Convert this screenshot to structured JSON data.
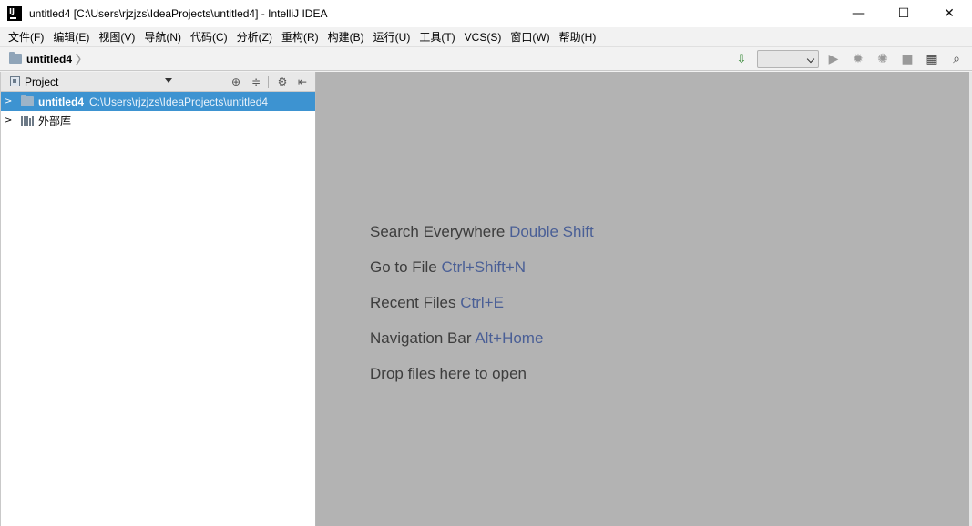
{
  "window": {
    "title": "untitled4 [C:\\Users\\rjzjzs\\IdeaProjects\\untitled4] - IntelliJ IDEA",
    "minimize_glyph": "—",
    "maximize_glyph": "☐",
    "close_glyph": "✕"
  },
  "menu": {
    "items": [
      {
        "label": "文件(F)"
      },
      {
        "label": "编辑(E)"
      },
      {
        "label": "视图(V)"
      },
      {
        "label": "导航(N)"
      },
      {
        "label": "代码(C)"
      },
      {
        "label": "分析(Z)"
      },
      {
        "label": "重构(R)"
      },
      {
        "label": "构建(B)"
      },
      {
        "label": "运行(U)"
      },
      {
        "label": "工具(T)"
      },
      {
        "label": "VCS(S)"
      },
      {
        "label": "窗口(W)"
      },
      {
        "label": "帮助(H)"
      }
    ]
  },
  "navbar": {
    "breadcrumb": "untitled4",
    "separator": "〉",
    "run_config_value": ""
  },
  "toolbar": {
    "icons": {
      "sort": "⇩",
      "run": "▶",
      "debug": "✹",
      "coverage": "✺",
      "stop": "■",
      "project_structure": "▦",
      "search": "⌕"
    }
  },
  "project_panel": {
    "title": "Project",
    "tools": {
      "locate": "⊕",
      "collapse": "≑",
      "settings": "⚙",
      "hide": "⇤"
    },
    "tree": [
      {
        "arrow": ">",
        "name": "untitled4",
        "path": "C:\\Users\\rjzjzs\\IdeaProjects\\untitled4",
        "selected": true
      },
      {
        "arrow": ">",
        "name": "外部库",
        "selected": false
      }
    ]
  },
  "editor": {
    "hints": [
      {
        "text": "Search Everywhere",
        "shortcut": "Double Shift"
      },
      {
        "text": "Go to File",
        "shortcut": "Ctrl+Shift+N"
      },
      {
        "text": "Recent Files",
        "shortcut": "Ctrl+E"
      },
      {
        "text": "Navigation Bar",
        "shortcut": "Alt+Home"
      },
      {
        "text": "Drop files here to open",
        "shortcut": ""
      }
    ]
  },
  "colors": {
    "selection": "#3d93d1",
    "editor_background": "#b3b3b3",
    "shortcut_text": "#4a5f96"
  }
}
